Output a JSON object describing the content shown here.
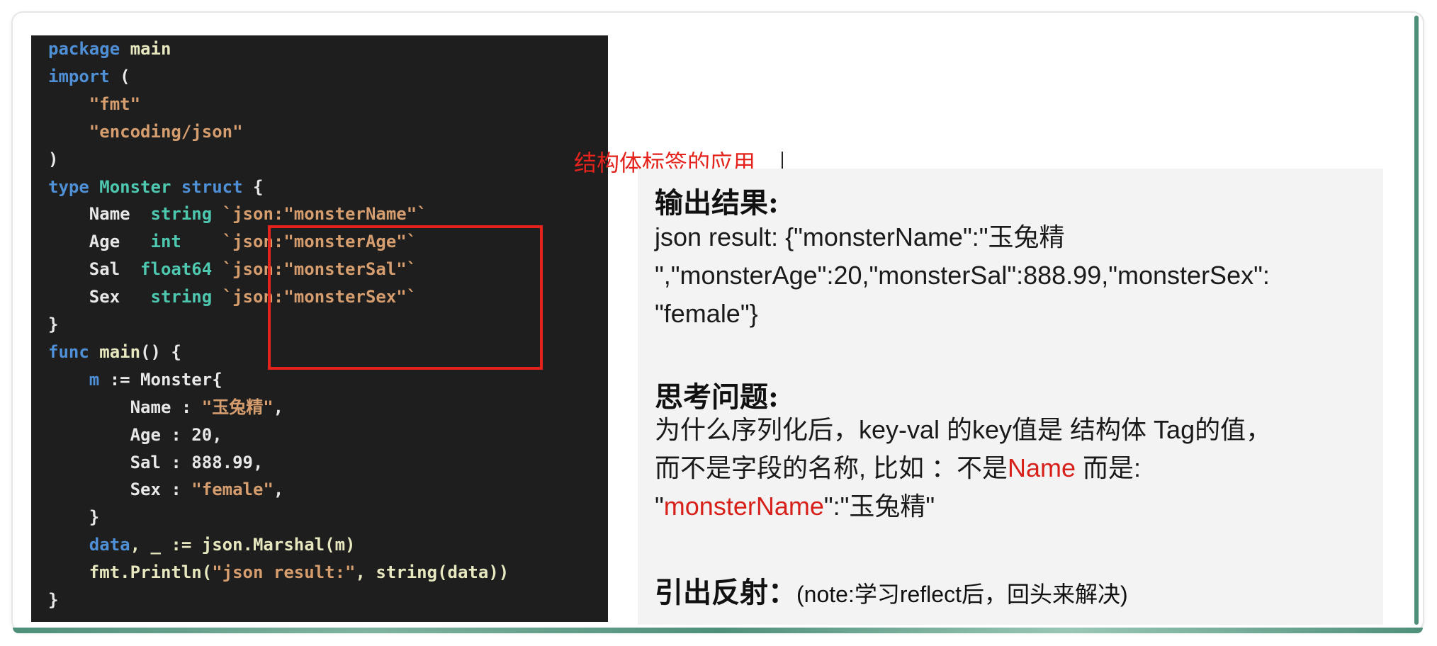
{
  "code": {
    "lines": [
      [
        {
          "t": "package ",
          "c": "kw"
        },
        {
          "t": "main",
          "c": "fn"
        }
      ],
      [
        {
          "t": "import ",
          "c": "kw"
        },
        {
          "t": "(",
          "c": ""
        }
      ],
      [
        {
          "t": "    ",
          "c": ""
        },
        {
          "t": "\"fmt\"",
          "c": "str"
        }
      ],
      [
        {
          "t": "    ",
          "c": ""
        },
        {
          "t": "\"encoding/json\"",
          "c": "str"
        }
      ],
      [
        {
          "t": ")",
          "c": ""
        }
      ],
      [
        {
          "t": "type ",
          "c": "kw"
        },
        {
          "t": "Monster ",
          "c": "ty"
        },
        {
          "t": "struct ",
          "c": "kw"
        },
        {
          "t": "{",
          "c": ""
        }
      ],
      [
        {
          "t": "    Name  ",
          "c": ""
        },
        {
          "t": "string ",
          "c": "ty"
        },
        {
          "t": "`json:\"monsterName\"`",
          "c": "str"
        }
      ],
      [
        {
          "t": "    Age   ",
          "c": ""
        },
        {
          "t": "int    ",
          "c": "ty"
        },
        {
          "t": "`json:\"monsterAge\"`",
          "c": "str"
        }
      ],
      [
        {
          "t": "    Sal  ",
          "c": ""
        },
        {
          "t": "float64 ",
          "c": "ty"
        },
        {
          "t": "`json:\"monsterSal\"`",
          "c": "str"
        }
      ],
      [
        {
          "t": "    Sex   ",
          "c": ""
        },
        {
          "t": "string ",
          "c": "ty"
        },
        {
          "t": "`json:\"monsterSex\"`",
          "c": "str"
        }
      ],
      [
        {
          "t": "}",
          "c": ""
        }
      ],
      [
        {
          "t": "func ",
          "c": "kw"
        },
        {
          "t": "main",
          "c": "fn"
        },
        {
          "t": "() {",
          "c": ""
        }
      ],
      [
        {
          "t": "    ",
          "c": ""
        },
        {
          "t": "m",
          "c": "kw"
        },
        {
          "t": " := Monster{",
          "c": ""
        }
      ],
      [
        {
          "t": "        Name : ",
          "c": ""
        },
        {
          "t": "\"玉兔精\"",
          "c": "str"
        },
        {
          "t": ",",
          "c": ""
        }
      ],
      [
        {
          "t": "        Age : ",
          "c": ""
        },
        {
          "t": "20",
          "c": "num"
        },
        {
          "t": ",",
          "c": ""
        }
      ],
      [
        {
          "t": "        Sal : ",
          "c": ""
        },
        {
          "t": "888.99",
          "c": "num"
        },
        {
          "t": ",",
          "c": ""
        }
      ],
      [
        {
          "t": "        Sex : ",
          "c": ""
        },
        {
          "t": "\"female\"",
          "c": "str"
        },
        {
          "t": ",",
          "c": ""
        }
      ],
      [
        {
          "t": "    }",
          "c": ""
        }
      ],
      [
        {
          "t": "    ",
          "c": ""
        },
        {
          "t": "data",
          "c": "kw"
        },
        {
          "t": ", _ := json.Marshal(m)",
          "c": "fn"
        }
      ],
      [
        {
          "t": "    fmt.Println(",
          "c": "fn"
        },
        {
          "t": "\"json result:\"",
          "c": "str"
        },
        {
          "t": ", string(data))",
          "c": "fn"
        }
      ],
      [
        {
          "t": "}",
          "c": ""
        }
      ]
    ]
  },
  "caption": "结构体标签的应用",
  "output": {
    "heading": "输出结果:",
    "line1": "json result: {\"monsterName\":\"玉兔精",
    "line2": "\",\"monsterAge\":20,\"monsterSal\":888.99,\"monsterSex\":",
    "line3": "\"female\"}"
  },
  "question": {
    "heading": "思考问题:",
    "line1": "为什么序列化后，key-val 的key值是 结构体 Tag的值，",
    "line2_pre": "而不是字段的名称, 比如 ：不是",
    "line2_red": "Name",
    "line2_post": " 而是:",
    "line3_q1": "\"",
    "line3_red": "monsterName",
    "line3_post": "\":\"玉兔精\""
  },
  "reflect": {
    "heading": "引出反射：",
    "note": "(note:学习reflect后，回头来解决)"
  },
  "colors": {
    "accent_red": "#e3231c",
    "code_bg": "#1e1e1e",
    "panel_bg": "#f3f3f3"
  }
}
